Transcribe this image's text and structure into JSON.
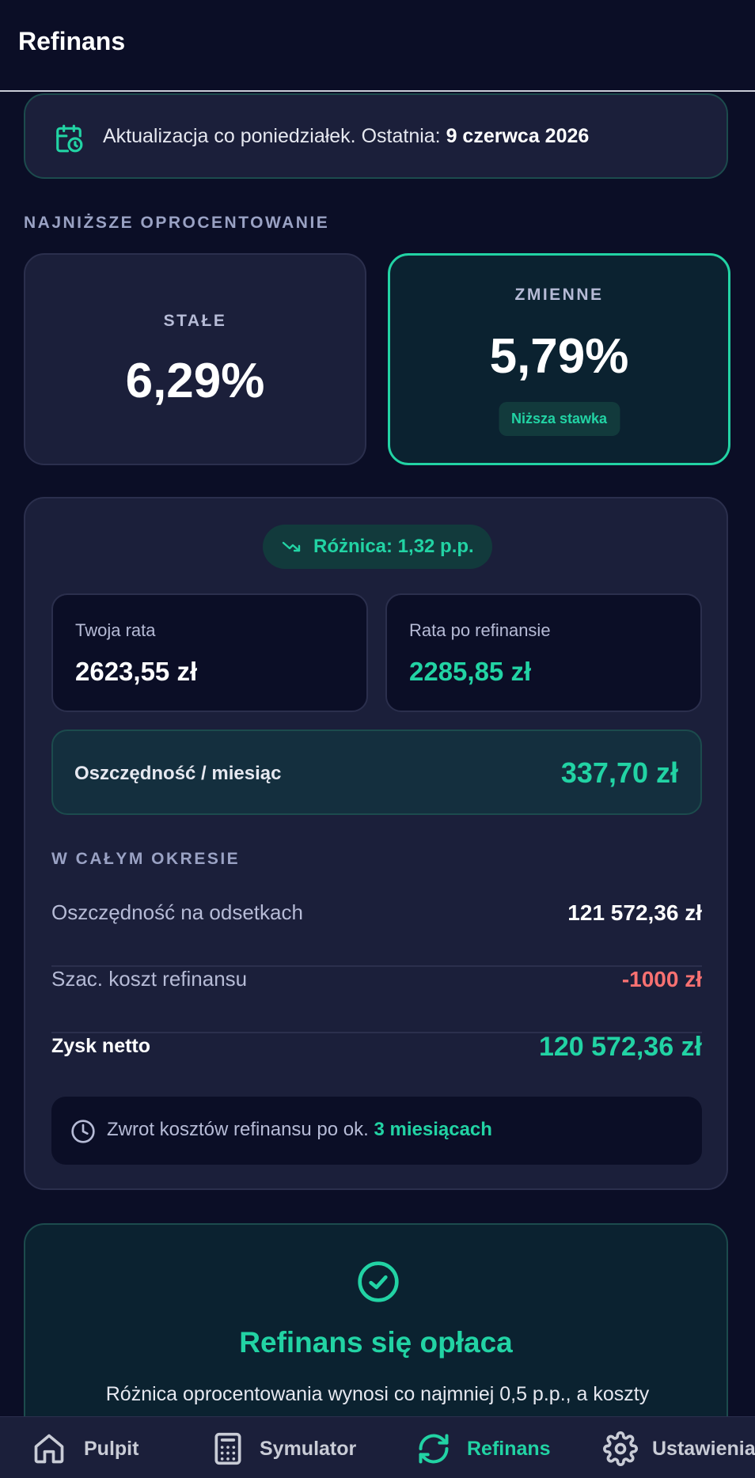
{
  "header": {
    "title": "Refinans"
  },
  "update": {
    "text": "Aktualizacja co poniedziałek. Ostatnia:",
    "date": "9 czerwca 2026",
    "icon": "calendar-clock-icon"
  },
  "rates": {
    "section_label": "NAJNIŻSZE OPROCENTOWANIE",
    "fixed": {
      "label": "STAŁE",
      "value": "6,29%"
    },
    "variable": {
      "label": "ZMIENNE",
      "value": "5,79%",
      "badge": "Niższa stawka"
    }
  },
  "calc": {
    "difference": "Różnica: 1,32 p.p.",
    "current_installment": {
      "label": "Twoja rata",
      "value": "2623,55 zł"
    },
    "new_installment": {
      "label": "Rata po refinansie",
      "value": "2285,85 zł"
    },
    "monthly_saving": {
      "label": "Oszczędność / miesiąc",
      "value": "337,70 zł"
    },
    "period": {
      "section_label": "W CAŁYM OKRESIE",
      "interest_saving": {
        "label": "Oszczędność na odsetkach",
        "value": "121 572,36 zł"
      },
      "cost": {
        "label": "Szac. koszt refinansu",
        "value": "-1000 zł"
      },
      "net": {
        "label": "Zysk netto",
        "value": "120 572,36 zł"
      }
    },
    "payback": {
      "text": "Zwrot kosztów refinansu po ok.",
      "highlight": "3 miesiącach"
    }
  },
  "verdict": {
    "title": "Refinans się opłaca",
    "text": "Różnica oprocentowania wynosi co najmniej 0,5 p.p., a koszty"
  },
  "nav": {
    "items": [
      {
        "label": "Pulpit",
        "icon": "home-icon",
        "active": false
      },
      {
        "label": "Symulator",
        "icon": "calculator-icon",
        "active": false
      },
      {
        "label": "Refinans",
        "icon": "refresh-icon",
        "active": true
      },
      {
        "label": "Ustawienia",
        "icon": "gear-icon",
        "active": false
      }
    ]
  },
  "colors": {
    "background": "#0b0e26",
    "card": "#1b1f3a",
    "accent": "#22d3a4",
    "negative": "#f87171"
  }
}
